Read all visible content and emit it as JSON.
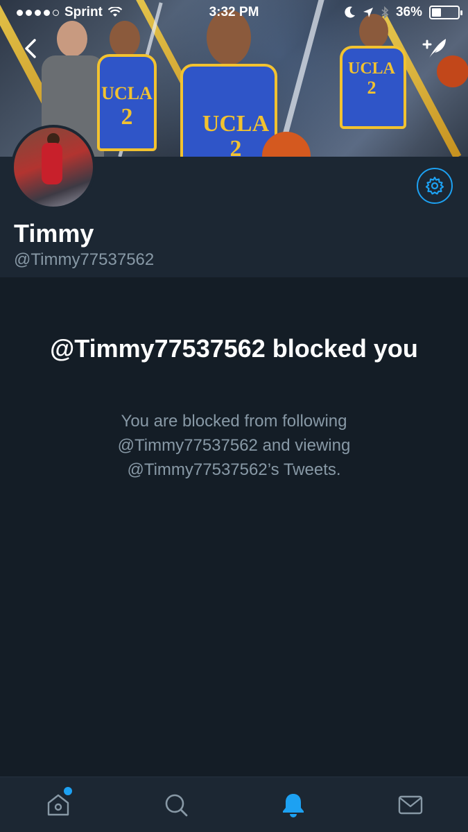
{
  "status_bar": {
    "carrier": "Sprint",
    "time": "3:32 PM",
    "battery_percent": "36%",
    "battery_level": 0.36
  },
  "header": {
    "back_icon": "chevron-left-icon",
    "compose_icon": "compose-tweet-icon"
  },
  "profile": {
    "name": "Timmy",
    "handle": "@Timmy77537562",
    "settings_icon": "gear-icon"
  },
  "blocked": {
    "title": "@Timmy77537562 blocked you",
    "description": "You are blocked from following @Timmy77537562 and viewing @Timmy77537562’s Tweets."
  },
  "tabbar": {
    "tabs": [
      {
        "icon": "home-icon",
        "active": false,
        "has_badge": true
      },
      {
        "icon": "search-icon",
        "active": false,
        "has_badge": false
      },
      {
        "icon": "bell-icon",
        "active": true,
        "has_badge": false
      },
      {
        "icon": "mail-icon",
        "active": false,
        "has_badge": false
      }
    ]
  },
  "colors": {
    "accent": "#1da1f2",
    "background": "#141d26",
    "panel": "#1c2733",
    "muted_text": "#8899a6"
  }
}
